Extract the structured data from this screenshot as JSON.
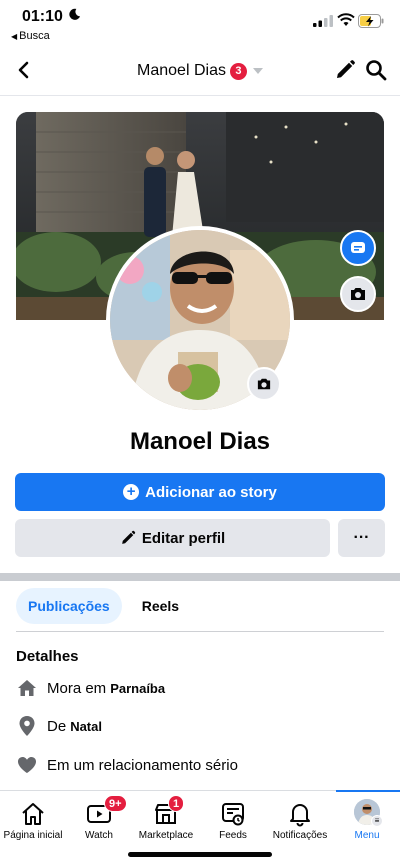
{
  "status_bar": {
    "time": "01:10",
    "back_app_label": "Busca"
  },
  "nav": {
    "title": "Manoel Dias",
    "badge_count": "3"
  },
  "profile": {
    "name": "Manoel Dias",
    "add_story_label": "Adicionar ao story",
    "edit_profile_label": "Editar perfil",
    "more_label": "···"
  },
  "tabs": {
    "items": [
      {
        "label": "Publicações",
        "active": true
      },
      {
        "label": "Reels",
        "active": false
      }
    ]
  },
  "details": {
    "title": "Detalhes",
    "lives_prefix": "Mora em",
    "lives_city": "Parnaíba",
    "from_prefix": "De",
    "from_city": "Natal",
    "relationship": "Em um relacionamento sério"
  },
  "tabbar": {
    "items": [
      {
        "label": "Página inicial",
        "icon": "home-icon",
        "badge": ""
      },
      {
        "label": "Watch",
        "icon": "watch-icon",
        "badge": "9+"
      },
      {
        "label": "Marketplace",
        "icon": "marketplace-icon",
        "badge": "1"
      },
      {
        "label": "Feeds",
        "icon": "feeds-icon",
        "badge": ""
      },
      {
        "label": "Notificações",
        "icon": "bell-icon",
        "badge": ""
      },
      {
        "label": "Menu",
        "icon": "menu-avatar",
        "badge": "",
        "active": true
      }
    ]
  },
  "colors": {
    "brand_blue": "#1877f2",
    "badge_red": "#e41e3f",
    "secondary_button": "#e4e6eb"
  }
}
